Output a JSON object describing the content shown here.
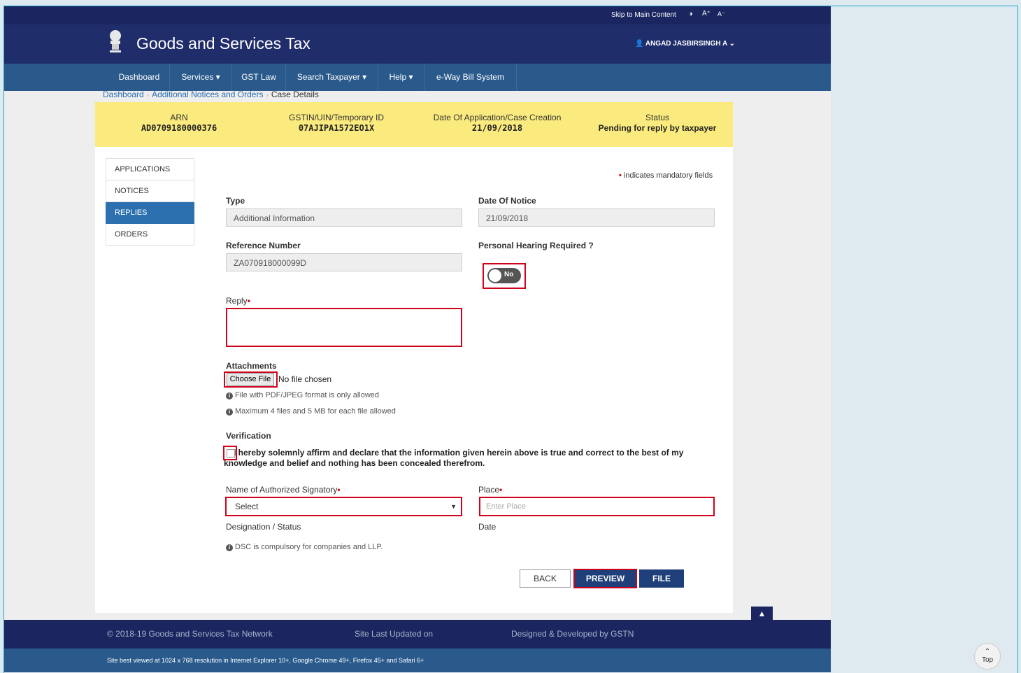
{
  "header": {
    "skip": "Skip to Main Content",
    "contrast_icon": "◑",
    "font_plus": "A⁺",
    "font_minus": "A⁻",
    "brand": "Goods and Services Tax",
    "user": "👤 ANGAD JASBIRSINGH A ⌄"
  },
  "nav": [
    {
      "label": "Dashboard"
    },
    {
      "label": "Services ▾"
    },
    {
      "label": "GST Law"
    },
    {
      "label": "Search Taxpayer ▾"
    },
    {
      "label": "Help ▾"
    },
    {
      "label": "e-Way Bill System"
    }
  ],
  "breadcrumb": {
    "items": [
      "Dashboard",
      "Additional Notices and Orders"
    ],
    "current": "Case Details",
    "sep": "›"
  },
  "summary": {
    "arn_label": "ARN",
    "arn": "AD0709180000376",
    "gstin_label": "GSTIN/UIN/Temporary ID",
    "gstin": "07AJIPA1572EO1X",
    "date_label": "Date Of Application/Case Creation",
    "date": "21/09/2018",
    "status_label": "Status",
    "status": "Pending for reply by taxpayer"
  },
  "tabs": [
    {
      "label": "APPLICATIONS",
      "active": false
    },
    {
      "label": "NOTICES",
      "active": false
    },
    {
      "label": "REPLIES",
      "active": true
    },
    {
      "label": "ORDERS",
      "active": false
    }
  ],
  "form": {
    "mandatory_dot": "•",
    "mandatory_note": "indicates mandatory fields",
    "type_label": "Type",
    "type_value": "Additional Information",
    "date_notice_label": "Date Of Notice",
    "date_notice_value": "21/09/2018",
    "ref_label": "Reference Number",
    "ref_value": "ZA070918000099D",
    "hearing_label": "Personal Hearing Required ?",
    "hearing_value": "No",
    "reply_label": "Reply",
    "req": "•",
    "attach_label": "Attachments",
    "choose_file": "Choose File",
    "no_file": "No file chosen",
    "note_format": "File with PDF/JPEG format is only allowed",
    "note_size": "Maximum 4 files and 5 MB for each file allowed",
    "verification_label": "Verification",
    "declaration": "I hereby solemnly affirm and declare that the information given herein above is true and correct to the best of my knowledge and belief and nothing has been concealed therefrom.",
    "signatory_label": "Name of Authorized Signatory",
    "signatory_value": "Select",
    "place_label": "Place",
    "place_placeholder": "Enter Place",
    "designation_label": "Designation / Status",
    "date_label": "Date",
    "dsc_note": "DSC is compulsory for companies and LLP.",
    "info_icon": "i"
  },
  "buttons": {
    "back": "BACK",
    "preview": "PREVIEW",
    "file": "FILE"
  },
  "footer": {
    "copyright": "© 2018-19 Goods and Services Tax Network",
    "updated": "Site Last Updated on",
    "designed": "Designed & Developed by GSTN",
    "best_viewed": "Site best viewed at 1024 x 768 resolution in Internet Explorer 10+, Google Chrome 49+, Firefox 45+ and Safari 6+"
  },
  "scroll_top": {
    "arrow": "⌃",
    "label": "Top"
  }
}
